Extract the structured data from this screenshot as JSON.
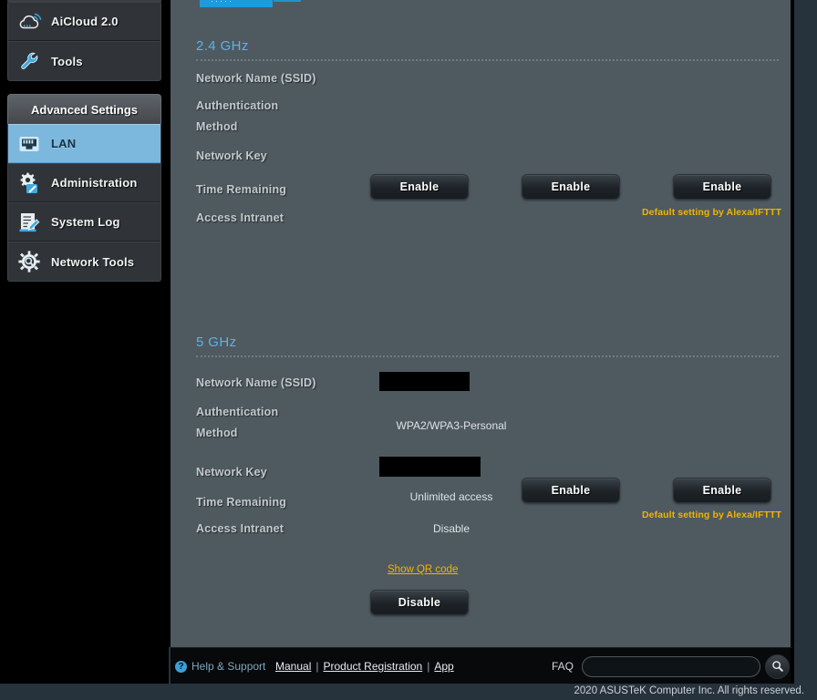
{
  "sidebar": {
    "top_items": [
      {
        "label": "AiCloud 2.0",
        "icon": "cloud-icon"
      },
      {
        "label": "Tools",
        "icon": "wrench-icon"
      }
    ],
    "group_title": "Advanced Settings",
    "group_items": [
      {
        "label": "LAN",
        "icon": "lan-port-icon",
        "active": true
      },
      {
        "label": "Administration",
        "icon": "gear-pencil-icon",
        "active": false
      },
      {
        "label": "System Log",
        "icon": "log-pencil-icon",
        "active": false
      },
      {
        "label": "Network Tools",
        "icon": "gear-magnifier-icon",
        "active": false
      }
    ]
  },
  "panel": {
    "sections": [
      {
        "title": "2.4 GHz",
        "labels": {
          "ssid": "Network Name (SSID)",
          "auth": "Authentication Method",
          "auth_line1": "Authentication",
          "auth_line2": "Method",
          "key": "Network Key",
          "time": "Time Remaining",
          "intranet": "Access Intranet"
        },
        "values": {
          "ssid": "",
          "auth": "",
          "key": "",
          "time": "",
          "intranet": ""
        },
        "buttons": [
          {
            "label": "Enable"
          },
          {
            "label": "Enable"
          },
          {
            "label": "Enable"
          }
        ],
        "note": "Default setting by Alexa/IFTTT"
      },
      {
        "title": "5 GHz",
        "labels": {
          "ssid": "Network Name (SSID)",
          "auth_line1": "Authentication",
          "auth_line2": "Method",
          "key": "Network Key",
          "time": "Time Remaining",
          "intranet": "Access Intranet"
        },
        "values": {
          "ssid": "",
          "auth": "WPA2/WPA3-Personal",
          "key": "",
          "time": "Unlimited access",
          "intranet": "Disable"
        },
        "buttons": [
          {
            "label": "Enable"
          },
          {
            "label": "Enable"
          }
        ],
        "note": "Default setting by Alexa/IFTTT",
        "qr_link": "Show QR code",
        "disable_button": "Disable"
      }
    ]
  },
  "footer": {
    "help_icon": "question-mark-icon",
    "help_label": "Help & Support",
    "links": [
      {
        "label": "Manual"
      },
      {
        "label": "Product Registration"
      },
      {
        "label": "App"
      }
    ],
    "separator": "|",
    "faq_label": "FAQ",
    "faq_value": "",
    "faq_placeholder": "",
    "search_icon": "magnifier-icon"
  },
  "copyright": "2020 ASUSTeK Computer Inc. All rights reserved.",
  "colors": {
    "panel_bg": "#4f5960",
    "section_title": "#5ab4e6",
    "accent_yellow": "#f0b400",
    "active_item": "#7cb8dd",
    "sidebar_bg": "#000000"
  }
}
